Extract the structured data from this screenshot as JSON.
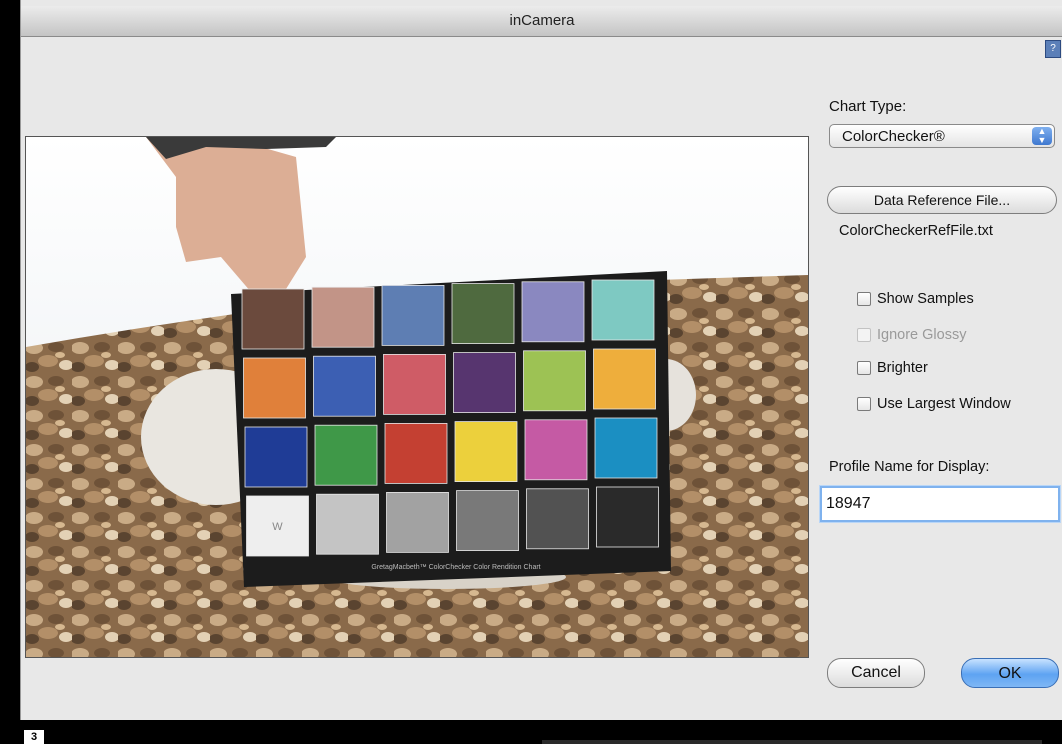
{
  "window": {
    "title": "inCamera"
  },
  "chart_type": {
    "label": "Chart Type:",
    "selected": "ColorChecker®"
  },
  "reference": {
    "button_label": "Data Reference File...",
    "file_name": "ColorCheckerRefFile.txt"
  },
  "options": {
    "show_samples": {
      "label": "Show Samples",
      "checked": false,
      "enabled": true
    },
    "ignore_glossy": {
      "label": "Ignore Glossy",
      "checked": false,
      "enabled": false
    },
    "brighter": {
      "label": "Brighter",
      "checked": false,
      "enabled": true
    },
    "use_largest_window": {
      "label": "Use Largest Window",
      "checked": false,
      "enabled": true
    }
  },
  "profile": {
    "label": "Profile Name for Display:",
    "value": "18947"
  },
  "buttons": {
    "cancel": "Cancel",
    "ok": "OK"
  },
  "preview": {
    "patch_w_label": "W",
    "chart_caption": "GretagMacbeth™ ColorChecker Color Rendition Chart",
    "patch_colors": [
      "#6b4a3d",
      "#c29487",
      "#5e7eb3",
      "#4f6a3f",
      "#8a88c0",
      "#7ec9c2",
      "#e0803a",
      "#3c5fb3",
      "#cf5c66",
      "#57356f",
      "#9dc254",
      "#eeae3c",
      "#1f3c96",
      "#3f9848",
      "#c44032",
      "#ecd03c",
      "#c55aa4",
      "#1b8fc2",
      "#eeeeee",
      "#c4c4c4",
      "#a2a2a2",
      "#797979",
      "#525252",
      "#2a2a2a"
    ]
  },
  "page_badge": "3"
}
